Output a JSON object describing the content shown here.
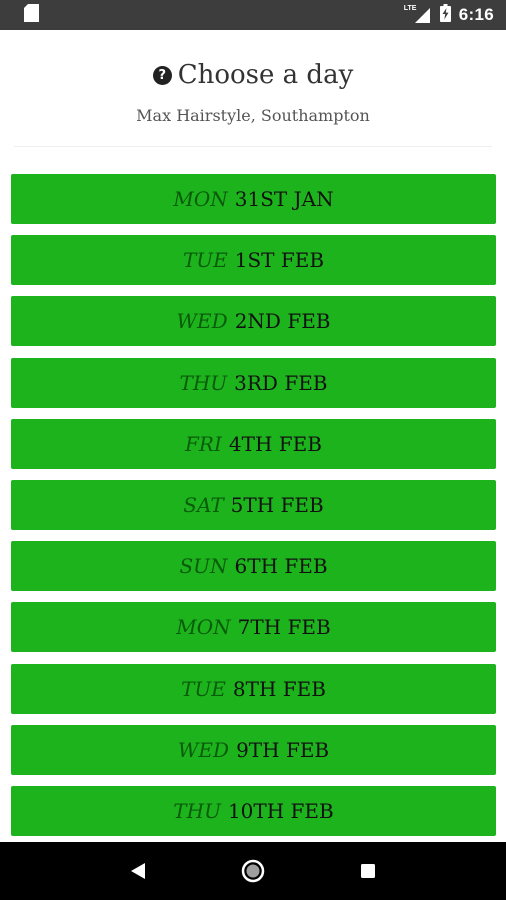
{
  "status_bar": {
    "network": "LTE",
    "time": "6:16"
  },
  "header": {
    "title": "Choose a day",
    "subtitle": "Max Hairstyle, Southampton"
  },
  "days": [
    {
      "weekday": "MON",
      "date": "31ST JAN"
    },
    {
      "weekday": "TUE",
      "date": "1ST FEB"
    },
    {
      "weekday": "WED",
      "date": "2ND FEB"
    },
    {
      "weekday": "THU",
      "date": "3RD FEB"
    },
    {
      "weekday": "FRI",
      "date": "4TH FEB"
    },
    {
      "weekday": "SAT",
      "date": "5TH FEB"
    },
    {
      "weekday": "SUN",
      "date": "6TH FEB"
    },
    {
      "weekday": "MON",
      "date": "7TH FEB"
    },
    {
      "weekday": "TUE",
      "date": "8TH FEB"
    },
    {
      "weekday": "WED",
      "date": "9TH FEB"
    },
    {
      "weekday": "THU",
      "date": "10TH FEB"
    }
  ],
  "colors": {
    "day_button_bg": "#1db31d",
    "weekday_text": "#0a5c0a",
    "status_bar_bg": "#3d3d3d",
    "nav_bar_bg": "#000000"
  },
  "icons": {
    "status_left": "sd-card-icon",
    "signal": "signal-icon",
    "battery": "battery-charging-icon",
    "title": "question-circle-icon",
    "nav": [
      "back-icon",
      "home-icon",
      "recents-icon"
    ]
  }
}
